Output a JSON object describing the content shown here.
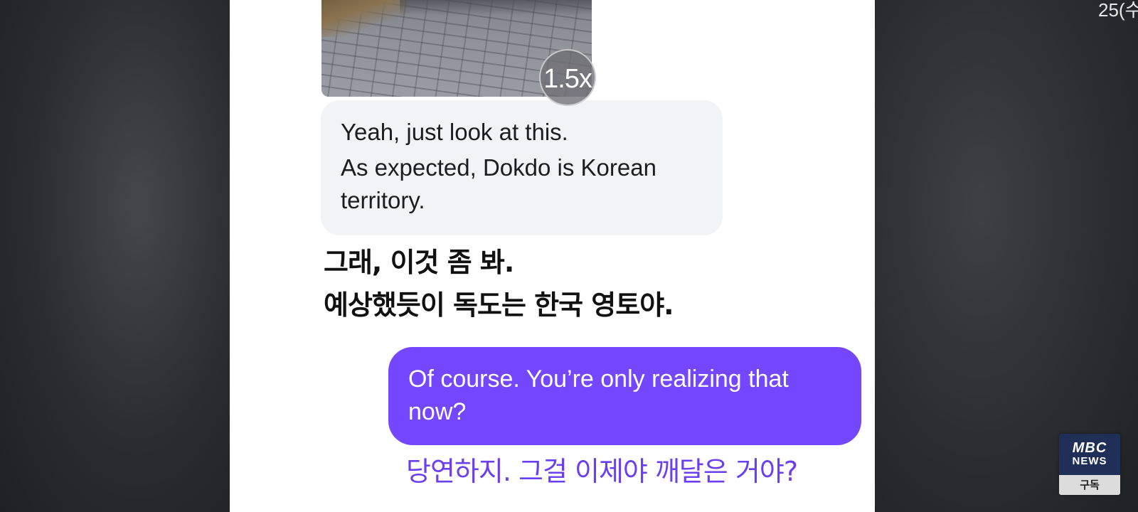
{
  "overlay": {
    "playback_speed": "1.5x",
    "corner_text": "25(수"
  },
  "chat": {
    "received": {
      "image_alt": "street-photo",
      "lines": [
        "Yeah, just look at this.",
        "As expected, Dokdo is Korean",
        "territory."
      ],
      "translation": [
        "그래, 이것 좀 봐.",
        "예상했듯이 독도는 한국 영토야."
      ]
    },
    "sent": {
      "lines": [
        "Of course. You’re only realizing that",
        "now?"
      ],
      "translation": "당연하지. 그걸 이제야 깨달은 거야?"
    }
  },
  "channel": {
    "logo": "MBC",
    "subtitle": "NEWS",
    "subscribe_label": "구독"
  },
  "colors": {
    "sent_bubble": "#7447ff",
    "received_bubble": "#f2f3f5",
    "sent_translation": "#6a3ff0"
  }
}
